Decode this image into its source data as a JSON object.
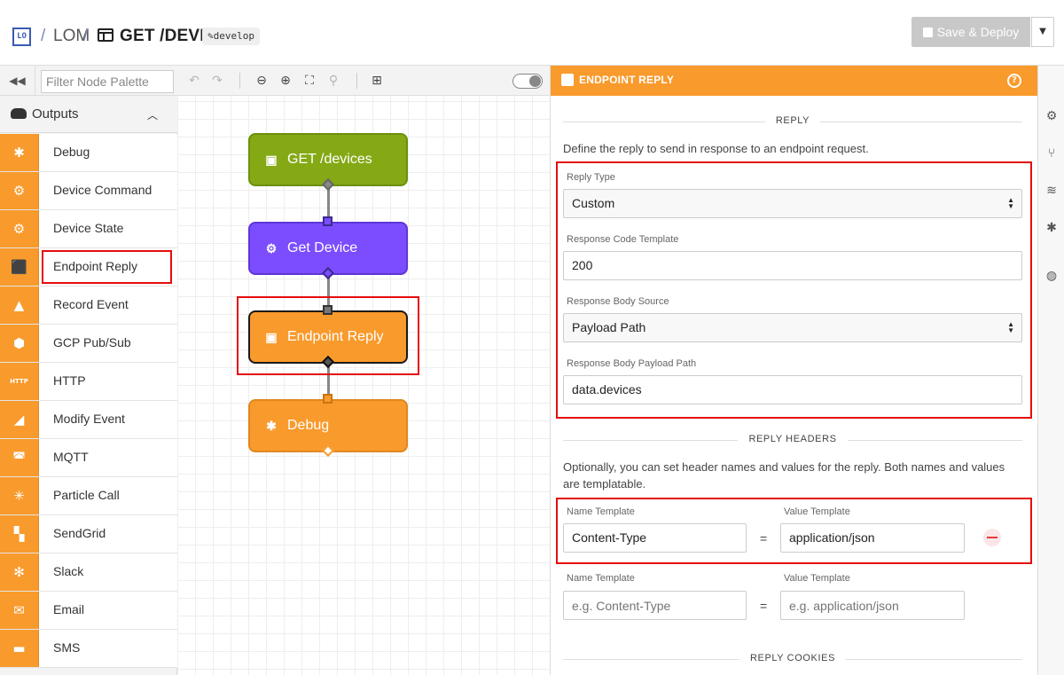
{
  "header": {
    "logo": "LO",
    "app_name": "LOM",
    "flow_name": "GET /DEVICES",
    "version": "✎develop",
    "save_deploy_label": "Save & Deploy"
  },
  "palette": {
    "filter_placeholder": "Filter Node Palette",
    "category": "Outputs",
    "nodes": [
      {
        "label": "Debug",
        "icon": "bug-icon"
      },
      {
        "label": "Device Command",
        "icon": "chip-icon"
      },
      {
        "label": "Device State",
        "icon": "chip-gear-icon"
      },
      {
        "label": "Endpoint Reply",
        "icon": "reply-icon"
      },
      {
        "label": "Record Event",
        "icon": "event-icon"
      },
      {
        "label": "GCP Pub/Sub",
        "icon": "gcp-icon"
      },
      {
        "label": "HTTP",
        "icon": "http-icon",
        "icon_text": "HTTP"
      },
      {
        "label": "Modify Event",
        "icon": "modify-icon"
      },
      {
        "label": "MQTT",
        "icon": "mqtt-icon"
      },
      {
        "label": "Particle Call",
        "icon": "particle-icon"
      },
      {
        "label": "SendGrid",
        "icon": "sendgrid-icon"
      },
      {
        "label": "Slack",
        "icon": "slack-icon"
      },
      {
        "label": "Email",
        "icon": "envelope-icon"
      },
      {
        "label": "SMS",
        "icon": "sms-icon"
      }
    ]
  },
  "workspace": {
    "nodes": [
      {
        "label": "GET /devices",
        "color": "#84a915"
      },
      {
        "label": "Get Device",
        "color": "#7c4dff"
      },
      {
        "label": "Endpoint Reply",
        "color": "#f99a2c"
      },
      {
        "label": "Debug",
        "color": "#f99a2c"
      }
    ]
  },
  "props": {
    "title": "ENDPOINT REPLY",
    "reply_section": "REPLY",
    "reply_desc": "Define the reply to send in response to an endpoint request.",
    "reply_type": {
      "label": "Reply Type",
      "value": "Custom"
    },
    "response_code": {
      "label": "Response Code Template",
      "value": "200"
    },
    "body_source": {
      "label": "Response Body Source",
      "value": "Payload Path"
    },
    "body_path": {
      "label": "Response Body Payload Path",
      "value": "data.devices"
    },
    "headers_section": "REPLY HEADERS",
    "headers_desc": "Optionally, you can set header names and values for the reply. Both names and values are templatable.",
    "header_rows": [
      {
        "name_label": "Name Template",
        "value_label": "Value Template",
        "name_value": "Content-Type",
        "value_value": "application/json"
      },
      {
        "name_label": "Name Template",
        "value_label": "Value Template",
        "name_placeholder": "e.g. Content-Type",
        "value_placeholder": "e.g. application/json"
      }
    ],
    "equals": "=",
    "cookies_section": "REPLY COOKIES"
  },
  "colors": {
    "accent": "#f99a2c",
    "highlight": "#e40d0d",
    "brand_blue": "#3a5bb4"
  }
}
